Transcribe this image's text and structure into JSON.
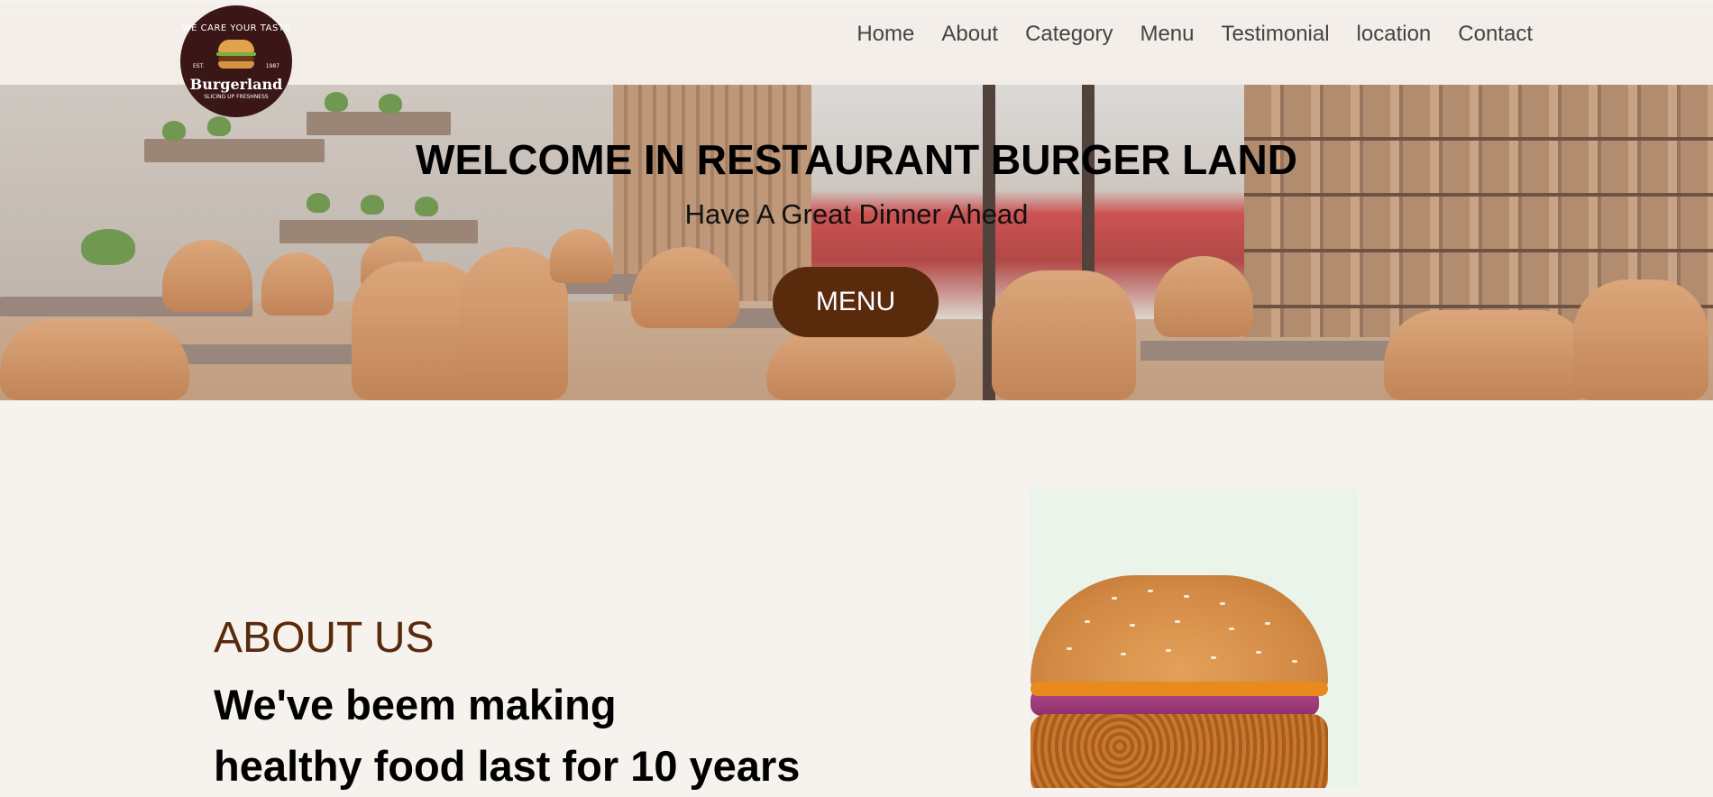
{
  "logo": {
    "arc_text": "WE CARE YOUR TASTE",
    "est_left": "EST.",
    "est_right": "1987",
    "brand": "Burgerland",
    "tagline": "SLICING UP FRESHNESS"
  },
  "nav": {
    "items": [
      "Home",
      "About",
      "Category",
      "Menu",
      "Testimonial",
      "location",
      "Contact"
    ]
  },
  "hero": {
    "title": "WELCOME IN RESTAURANT BURGER LAND",
    "subtitle": "Have A Great Dinner Ahead",
    "button_label": "MENU"
  },
  "about": {
    "label": "ABOUT US",
    "heading_line1": "We've beem making",
    "heading_line2": "healthy food last for 10 years"
  },
  "colors": {
    "accent": "#5a2a0c",
    "logo_bg": "#3b1616",
    "page_bg": "#f6f3ef"
  }
}
